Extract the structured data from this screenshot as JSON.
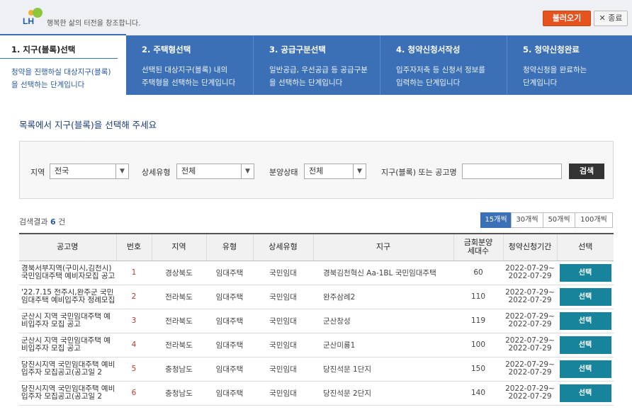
{
  "header": {
    "logo_text": "LH",
    "slogan": "행복한 삶의 터전을 창조합니다.",
    "load_button": "불러오기",
    "close_button": "✕ 종료"
  },
  "steps": [
    {
      "title": "1. 지구(블록)선택",
      "desc1": "청약을 진행하실 대상지구(블록)",
      "desc2": "을 선택하는 단계입니다"
    },
    {
      "title": "2. 주택형선택",
      "desc1": "선택된 대상지구(블록) 내의",
      "desc2": "주택형을 선택하는 단계입니다"
    },
    {
      "title": "3. 공급구분선택",
      "desc1": "일반공급, 우선공급 등 공급구분",
      "desc2": "을 선택하는 단계입니다"
    },
    {
      "title": "4. 청약신청서작성",
      "desc1": "입주자저축 등 신청서 정보를",
      "desc2": "입력하는 단계입니다"
    },
    {
      "title": "5. 청약신청완료",
      "desc1": "청약신청을 완료하는",
      "desc2": "단계입니다"
    }
  ],
  "heading": "목록에서 지구(블록)을 선택해 주세요",
  "search": {
    "region_label": "지역",
    "region_value": "전국",
    "detail_label": "상세유형",
    "detail_value": "전체",
    "status_label": "분양상태",
    "status_value": "전체",
    "keyword_label": "지구(블록) 또는 공고명",
    "keyword_value": "",
    "search_button": "검색"
  },
  "result": {
    "prefix": "검색결과",
    "count": "6",
    "suffix": "건"
  },
  "page_sizes": [
    "15개씩",
    "30개씩",
    "50개씩",
    "100개씩"
  ],
  "table": {
    "headers": {
      "name": "공고명",
      "no": "번호",
      "region": "지역",
      "type": "유형",
      "detail": "상세유형",
      "danji": "지구",
      "units1": "금회분양",
      "units2": "세대수",
      "period": "청약신청기간",
      "select": "선택"
    },
    "rows": [
      {
        "name": "경북서부지역(구미시,김천시) 국민임대주택 예비자모집 공고",
        "no": "1",
        "region": "경상북도",
        "type": "임대주택",
        "detail": "국민임대",
        "danji": "경북김천혁신 Aa-1BL 국민임대주택",
        "units": "60",
        "start": "2022-07-29~",
        "end": "2022-07-29",
        "btn": "선택"
      },
      {
        "name": "'22.7.15 전주시,완주군 국민임대주택 예비입주자 정례모집",
        "no": "2",
        "region": "전라북도",
        "type": "임대주택",
        "detail": "국민임대",
        "danji": "완주삼례2",
        "units": "110",
        "start": "2022-07-29~",
        "end": "2022-07-29",
        "btn": "선택"
      },
      {
        "name": "군산시 지역 국민임대주택 예비입주자 모집 공고",
        "no": "3",
        "region": "전라북도",
        "type": "임대주택",
        "detail": "국민임대",
        "danji": "군산창성",
        "units": "119",
        "start": "2022-07-29~",
        "end": "2022-07-29",
        "btn": "선택"
      },
      {
        "name": "군산시 지역 국민임대주택 예비입주자 모집 공고",
        "no": "4",
        "region": "전라북도",
        "type": "임대주택",
        "detail": "국민임대",
        "danji": "군산미룡1",
        "units": "100",
        "start": "2022-07-29~",
        "end": "2022-07-29",
        "btn": "선택"
      },
      {
        "name": "당진시지역 국민임대주택 예비입주자 모집공고(공고일 2",
        "no": "5",
        "region": "충청남도",
        "type": "임대주택",
        "detail": "국민임대",
        "danji": "당진석문 1단지",
        "units": "150",
        "start": "2022-07-29~",
        "end": "2022-07-29",
        "btn": "선택"
      },
      {
        "name": "당진시지역 국민임대주택 예비입주자 모집공고(공고일 2",
        "no": "6",
        "region": "충청남도",
        "type": "임대주택",
        "detail": "국민임대",
        "danji": "당진석문 2단지",
        "units": "140",
        "start": "2022-07-29~",
        "end": "2022-07-29",
        "btn": "선택"
      }
    ]
  },
  "colors": {
    "brand_blue": "#3b6fb6",
    "load_orange": "#e6531f",
    "select_teal": "#17849b"
  }
}
